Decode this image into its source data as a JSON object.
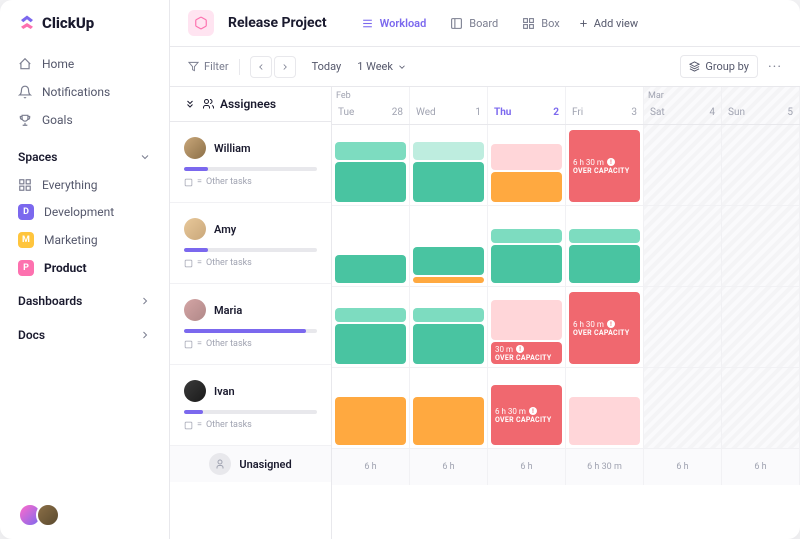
{
  "brand": "ClickUp",
  "nav": {
    "home": "Home",
    "notifications": "Notifications",
    "goals": "Goals"
  },
  "spaces": {
    "header": "Spaces",
    "everything": "Everything",
    "items": [
      {
        "label": "Development",
        "badge": "D"
      },
      {
        "label": "Marketing",
        "badge": "M"
      },
      {
        "label": "Product",
        "badge": "P"
      }
    ]
  },
  "sections": {
    "dashboards": "Dashboards",
    "docs": "Docs"
  },
  "project": {
    "title": "Release Project",
    "views": {
      "workload": "Workload",
      "board": "Board",
      "box": "Box",
      "add": "Add view"
    }
  },
  "toolbar": {
    "filter": "Filter",
    "today": "Today",
    "range": "1 Week",
    "groupby": "Group by"
  },
  "calendar": {
    "months": {
      "feb": "Feb",
      "mar": "Mar"
    },
    "days": [
      {
        "dow": "Tue",
        "num": "28"
      },
      {
        "dow": "Wed",
        "num": "1"
      },
      {
        "dow": "Thu",
        "num": "2",
        "today": true
      },
      {
        "dow": "Fri",
        "num": "3"
      },
      {
        "dow": "Sat",
        "num": "4",
        "weekend": true
      },
      {
        "dow": "Sun",
        "num": "5",
        "weekend": true
      }
    ]
  },
  "assignees": {
    "header": "Assignees",
    "other_tasks": "Other tasks",
    "unassigned": "Unasigned",
    "list": [
      {
        "name": "William",
        "progress": 18
      },
      {
        "name": "Amy",
        "progress": 18
      },
      {
        "name": "Maria",
        "progress": 92
      },
      {
        "name": "Ivan",
        "progress": 14
      }
    ]
  },
  "overcapacity": {
    "label": "OVER CAPACITY",
    "t1": "6 h 30 m",
    "t2": "30 m"
  },
  "totals": [
    "6 h",
    "6 h",
    "6 h",
    "6 h 30 m",
    "6 h",
    "6 h"
  ]
}
